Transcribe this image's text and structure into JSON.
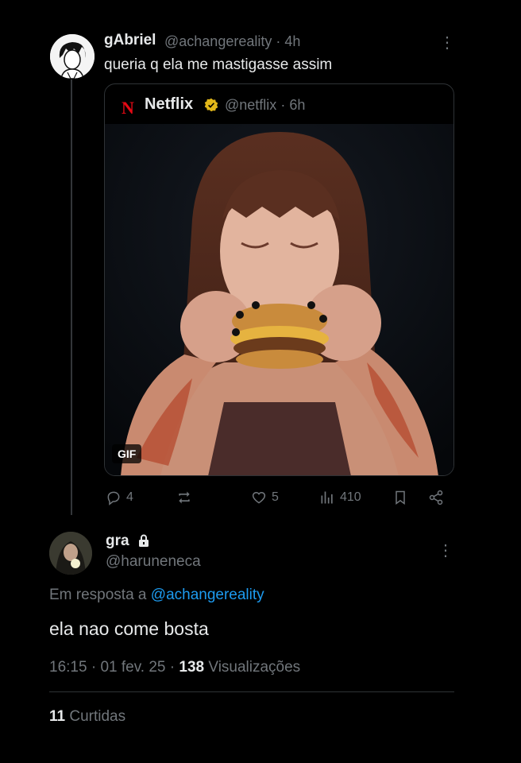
{
  "tweet": {
    "author_name": "gAbriel",
    "author_handle": "@achangereality",
    "time": "4h",
    "text": "queria q ela me mastigasse assim"
  },
  "quote": {
    "logo_letter": "N",
    "author_name": "Netflix",
    "author_handle": "@netflix",
    "time": "6h",
    "media_badge": "GIF"
  },
  "actions": {
    "replies": "4",
    "reposts": "",
    "likes": "5",
    "views": "410"
  },
  "reply": {
    "author_name": "gra",
    "author_handle": "@haruneneca",
    "reply_prefix": "Em resposta a",
    "reply_to": "@achangereality",
    "text": "ela nao come bosta",
    "time": "16:15",
    "date": "01 fev. 25",
    "views_count": "138",
    "views_label": "Visualizações",
    "likes_count": "11",
    "likes_label": "Curtidas"
  },
  "colors": {
    "background": "#000000",
    "text": "#e7e9ea",
    "muted": "#71767b",
    "link": "#1d9bf0",
    "netflix_red": "#e50914",
    "verified_gold": "#e2b719"
  },
  "icons": [
    "more-icon",
    "netflix-logo-icon",
    "verified-badge-icon",
    "reply-icon",
    "repost-icon",
    "like-icon",
    "views-icon",
    "bookmark-icon",
    "share-icon",
    "lock-icon"
  ]
}
